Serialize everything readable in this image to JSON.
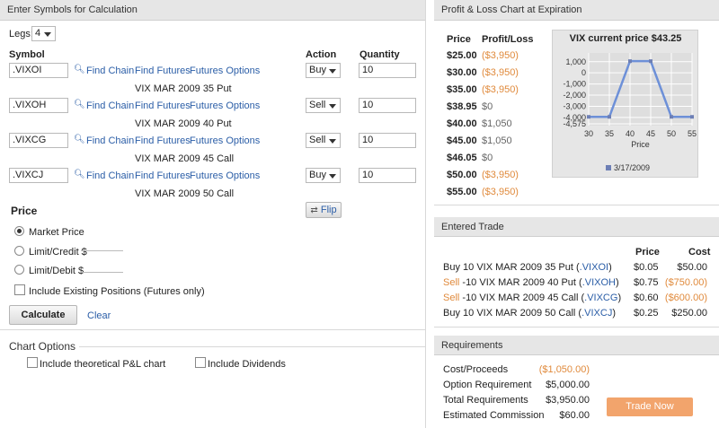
{
  "symbols_panel": {
    "title": "Enter Symbols for Calculation",
    "legs_label": "Legs:",
    "legs_value": "4",
    "col_symbol": "Symbol",
    "col_action": "Action",
    "col_quantity": "Quantity",
    "legs": [
      {
        "symbol": ".VIXOI",
        "find_chain": "Find Chain",
        "find_futures": "Find Futures",
        "futures_options": "Futures Options",
        "action": "Buy",
        "quantity": "10",
        "description": "VIX MAR 2009 35 Put"
      },
      {
        "symbol": ".VIXOH",
        "find_chain": "Find Chain",
        "find_futures": "Find Futures",
        "futures_options": "Futures Options",
        "action": "Sell",
        "quantity": "10",
        "description": "VIX MAR 2009 40 Put"
      },
      {
        "symbol": ".VIXCG",
        "find_chain": "Find Chain",
        "find_futures": "Find Futures",
        "futures_options": "Futures Options",
        "action": "Sell",
        "quantity": "10",
        "description": "VIX MAR 2009 45 Call"
      },
      {
        "symbol": ".VIXCJ",
        "find_chain": "Find Chain",
        "find_futures": "Find Futures",
        "futures_options": "Futures Options",
        "action": "Buy",
        "quantity": "10",
        "description": "VIX MAR 2009 50 Call"
      }
    ],
    "price_heading": "Price",
    "flip_label": "Flip",
    "market_price_label": "Market Price",
    "limit_credit_label": "Limit/Credit $",
    "limit_debit_label": "Limit/Debit $",
    "include_existing_label": "Include Existing Positions (Futures only)",
    "calculate_label": "Calculate",
    "clear_label": "Clear"
  },
  "chart_options": {
    "title": "Chart Options",
    "theoretical_label": "Include theoretical P&L chart",
    "dividends_label": "Include Dividends"
  },
  "pl_panel": {
    "title": "Profit & Loss Chart at Expiration",
    "col_price": "Price",
    "col_pl": "Profit/Loss",
    "rows": [
      {
        "price": "$25.00",
        "pl": "($3,950)",
        "tone": "orange"
      },
      {
        "price": "$30.00",
        "pl": "($3,950)",
        "tone": "orange"
      },
      {
        "price": "$35.00",
        "pl": "($3,950)",
        "tone": "orange"
      },
      {
        "price": "$38.95",
        "pl": "$0",
        "tone": "gray"
      },
      {
        "price": "$40.00",
        "pl": "$1,050",
        "tone": "gray"
      },
      {
        "price": "$45.00",
        "pl": "$1,050",
        "tone": "gray"
      },
      {
        "price": "$46.05",
        "pl": "$0",
        "tone": "gray"
      },
      {
        "price": "$50.00",
        "pl": "($3,950)",
        "tone": "orange"
      },
      {
        "price": "$55.00",
        "pl": "($3,950)",
        "tone": "orange"
      }
    ]
  },
  "chart_data": {
    "type": "line",
    "title": "VIX current price $43.25",
    "xlabel": "Price",
    "ylabel": "",
    "x": [
      30,
      35,
      40,
      45,
      50,
      55
    ],
    "series": [
      {
        "name": "3/17/2009",
        "values": [
          -3950,
          -3950,
          1050,
          1050,
          -3950,
          -3950
        ]
      }
    ],
    "xlim": [
      30,
      55
    ],
    "ylim": [
      -4575,
      1625
    ],
    "x_ticks": [
      "30",
      "35",
      "40",
      "45",
      "50",
      "55"
    ],
    "y_ticks": [
      "1,000",
      "0",
      "-1,000",
      "-2,000",
      "-3,000",
      "-4,000",
      "-4,575"
    ],
    "y_tick_values": [
      1000,
      0,
      -1000,
      -2000,
      -3000,
      -4000,
      -4575
    ],
    "grid": true,
    "legend_position": "bottom",
    "colors": {
      "line": "#6d90d8",
      "background": "#e6e6e6",
      "grid": "#ffffff"
    }
  },
  "entered_trade": {
    "title": "Entered Trade",
    "col_price": "Price",
    "col_cost": "Cost",
    "rows": [
      {
        "prefix": "Buy",
        "desc": " 10 VIX MAR 2009 35 Put (",
        "symbol": ".VIXOI",
        "close": ")",
        "price": "$0.05",
        "cost": "$50.00",
        "tone": "dark"
      },
      {
        "prefix": "Sell",
        "desc": " -10 VIX MAR 2009 40 Put (",
        "symbol": ".VIXOH",
        "close": ")",
        "price": "$0.75",
        "cost": "($750.00)",
        "tone": "orange"
      },
      {
        "prefix": "Sell",
        "desc": " -10 VIX MAR 2009 45 Call (",
        "symbol": ".VIXCG",
        "close": ")",
        "price": "$0.60",
        "cost": "($600.00)",
        "tone": "orange"
      },
      {
        "prefix": "Buy",
        "desc": " 10 VIX MAR 2009 50 Call (",
        "symbol": ".VIXCJ",
        "close": ")",
        "price": "$0.25",
        "cost": "$250.00",
        "tone": "dark"
      }
    ]
  },
  "requirements": {
    "title": "Requirements",
    "rows": [
      {
        "label": "Cost/Proceeds",
        "value": "($1,050.00)",
        "tone": "orange"
      },
      {
        "label": "Option Requirement",
        "value": "$5,000.00",
        "tone": "dark"
      },
      {
        "label": "Total Requirements",
        "value": "$3,950.00",
        "tone": "dark"
      },
      {
        "label": "Estimated Commission",
        "value": "$60.00",
        "tone": "dark"
      }
    ],
    "trade_now_label": "Trade Now"
  },
  "colors": {
    "accent_orange": "#e08a3c",
    "trade_button": "#f2a46c",
    "link_blue": "#2b5ea7",
    "header_bg": "#e6e6e6"
  }
}
